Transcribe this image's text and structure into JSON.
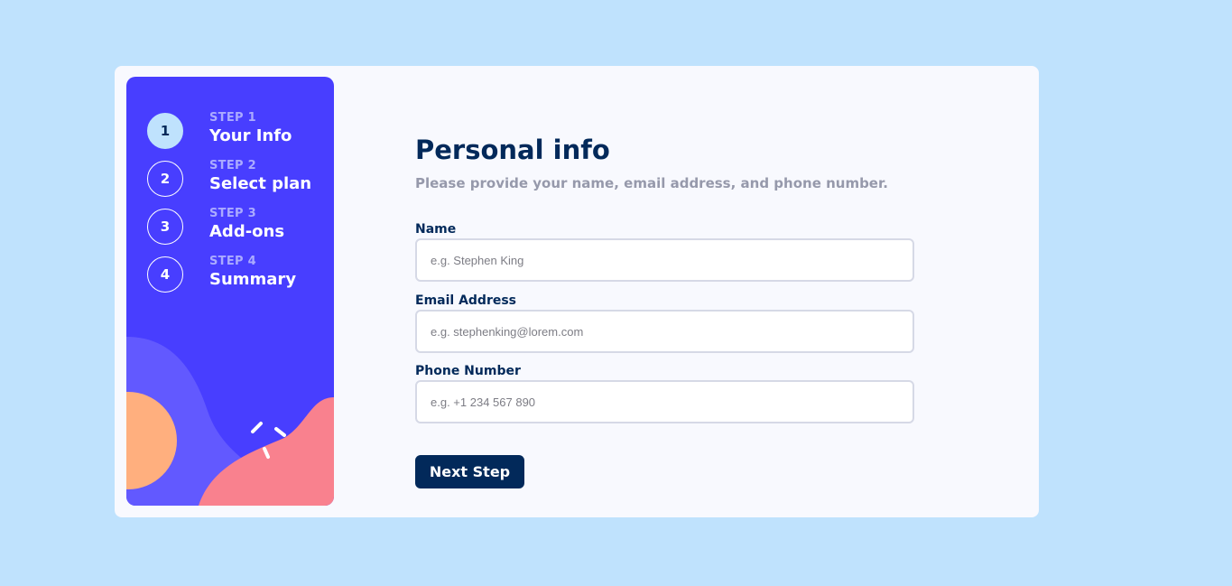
{
  "sidebar": {
    "steps": [
      {
        "number": "1",
        "label": "STEP 1",
        "title": "Your Info",
        "active": true
      },
      {
        "number": "2",
        "label": "STEP 2",
        "title": "Select plan",
        "active": false
      },
      {
        "number": "3",
        "label": "STEP 3",
        "title": "Add-ons",
        "active": false
      },
      {
        "number": "4",
        "label": "STEP 4",
        "title": "Summary",
        "active": false
      }
    ]
  },
  "form": {
    "title": "Personal info",
    "subtitle": "Please provide your name, email address, and phone number.",
    "fields": {
      "name": {
        "label": "Name",
        "placeholder": "e.g. Stephen King",
        "value": ""
      },
      "email": {
        "label": "Email Address",
        "placeholder": "e.g. stephenking@lorem.com",
        "value": ""
      },
      "phone": {
        "label": "Phone Number",
        "placeholder": "e.g. +1 234 567 890",
        "value": ""
      }
    },
    "next_label": "Next Step"
  },
  "colors": {
    "page_bg": "#bfe2fd",
    "sidebar_bg": "#483eff",
    "active_step": "#bfe2fd",
    "title": "#02295a",
    "button": "#02295a"
  }
}
